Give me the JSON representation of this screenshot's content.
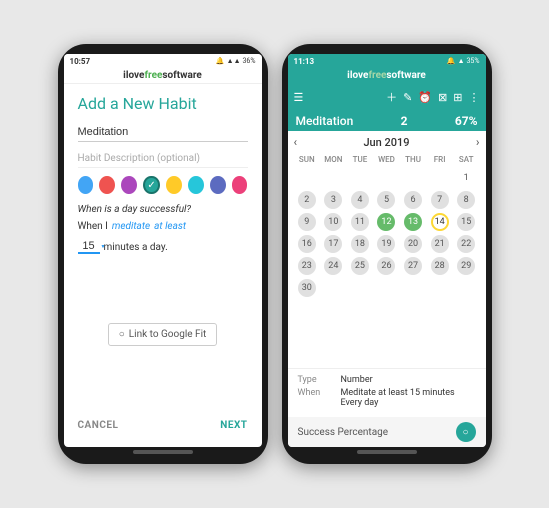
{
  "site": {
    "name_prefix": "ilove",
    "name_free": "free",
    "name_suffix": "software"
  },
  "phone1": {
    "status_time": "10:57",
    "status_icons": "🔔 📶 🔋 36%",
    "title": "Add a New Habit",
    "habit_name_value": "Meditation",
    "habit_desc_placeholder": "Habit Description (optional)",
    "colors": [
      "#42a5f5",
      "#ef5350",
      "#ab47bc",
      "#26a69a",
      "#ffca28",
      "#26c6da",
      "#5c6bc0",
      "#ec407a"
    ],
    "selected_color_index": 3,
    "when_successful_label": "When is a day successful?",
    "when_label": "When I",
    "when_value": "meditate",
    "when_condition": "at least",
    "minutes_value": "15",
    "minutes_label": "minutes a day.",
    "google_fit_label": "Link to Google Fit",
    "cancel_label": "CANCEL",
    "next_label": "NEXT"
  },
  "phone2": {
    "status_time": "11:13",
    "status_icons": "🔔 📶 🔋 35%",
    "toolbar_icons": [
      "≡",
      "➕",
      "✏️",
      "⏰",
      "✉",
      "≡",
      "⋮"
    ],
    "habit_name": "Meditation",
    "habit_count": "2",
    "habit_percent": "67%",
    "calendar": {
      "month": "Jun 2019",
      "days_header": [
        "SUN",
        "MON",
        "TUE",
        "WED",
        "THU",
        "FRI",
        "SAT"
      ],
      "weeks": [
        [
          null,
          null,
          null,
          null,
          null,
          null,
          1
        ],
        [
          2,
          3,
          4,
          5,
          6,
          7,
          8
        ],
        [
          9,
          10,
          11,
          12,
          13,
          14,
          15
        ],
        [
          16,
          17,
          18,
          19,
          20,
          21,
          22
        ],
        [
          23,
          24,
          25,
          26,
          27,
          28,
          29
        ],
        [
          30,
          null,
          null,
          null,
          null,
          null,
          null
        ]
      ],
      "completed_days": [
        12,
        13
      ],
      "today": 14
    },
    "type_label": "Type",
    "type_value": "Number",
    "when_label": "When",
    "when_value": "Meditate at least 15 minutes",
    "freq_value": "Every day",
    "success_label": "Success Percentage"
  }
}
